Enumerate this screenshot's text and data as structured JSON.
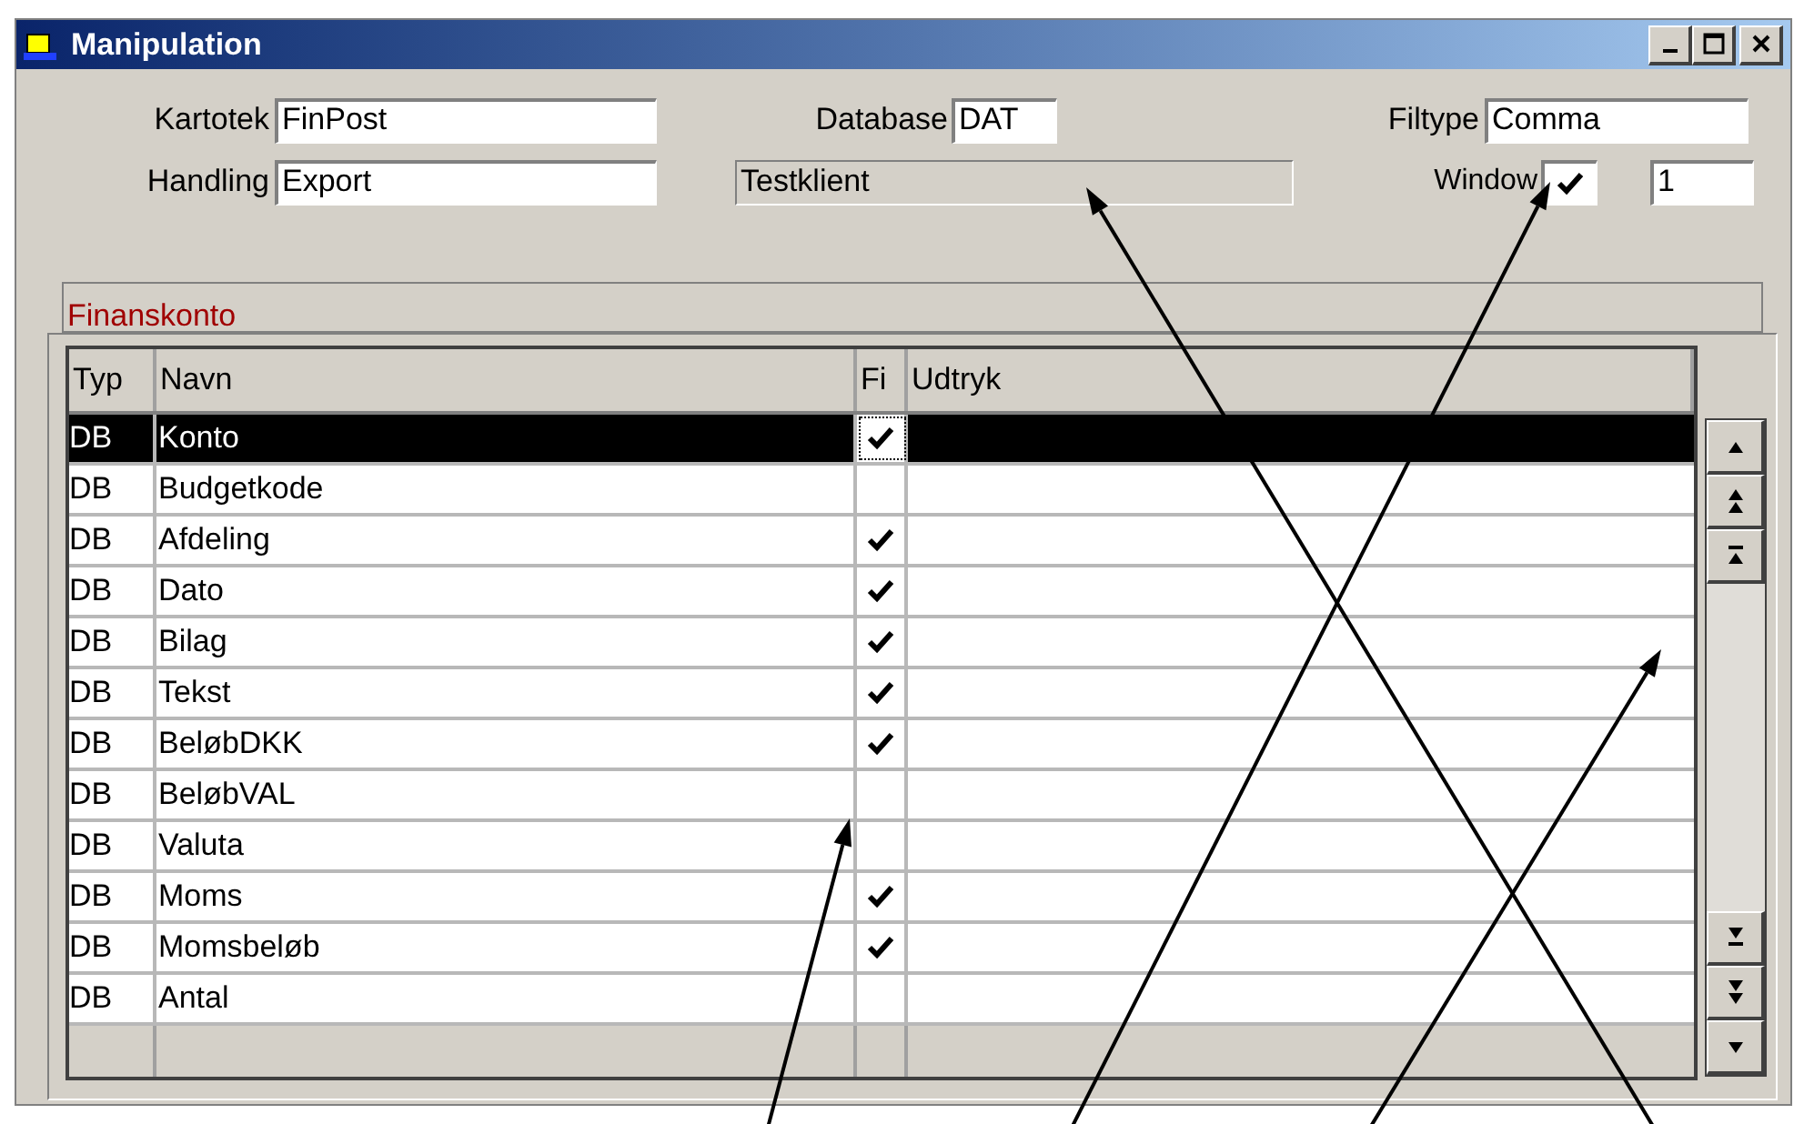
{
  "window": {
    "title": "Manipulation"
  },
  "fields": {
    "kartotek": {
      "label": "Kartotek",
      "value": "FinPost"
    },
    "database": {
      "label": "Database",
      "value": "DAT"
    },
    "filtype": {
      "label": "Filtype",
      "value": "Comma"
    },
    "handling": {
      "label": "Handling",
      "value": "Export"
    },
    "client": "Testklient",
    "window": {
      "label": "Window",
      "checked": true,
      "value": "1"
    }
  },
  "group": {
    "title": "Finanskonto"
  },
  "table": {
    "columns": [
      "Typ",
      "Navn",
      "Fi",
      "Udtryk"
    ],
    "rows": [
      {
        "typ": "DB",
        "navn": "Konto",
        "checked": true,
        "selected": true
      },
      {
        "typ": "DB",
        "navn": "Budgetkode",
        "checked": false,
        "selected": false
      },
      {
        "typ": "DB",
        "navn": "Afdeling",
        "checked": true,
        "selected": false
      },
      {
        "typ": "DB",
        "navn": "Dato",
        "checked": true,
        "selected": false
      },
      {
        "typ": "DB",
        "navn": "Bilag",
        "checked": true,
        "selected": false
      },
      {
        "typ": "DB",
        "navn": "Tekst",
        "checked": true,
        "selected": false
      },
      {
        "typ": "DB",
        "navn": "BeløbDKK",
        "checked": true,
        "selected": false
      },
      {
        "typ": "DB",
        "navn": "BeløbVAL",
        "checked": false,
        "selected": false
      },
      {
        "typ": "DB",
        "navn": "Valuta",
        "checked": false,
        "selected": false
      },
      {
        "typ": "DB",
        "navn": "Moms",
        "checked": true,
        "selected": false
      },
      {
        "typ": "DB",
        "navn": "Momsbeløb",
        "checked": true,
        "selected": false
      },
      {
        "typ": "DB",
        "navn": "Antal",
        "checked": false,
        "selected": false
      }
    ]
  }
}
